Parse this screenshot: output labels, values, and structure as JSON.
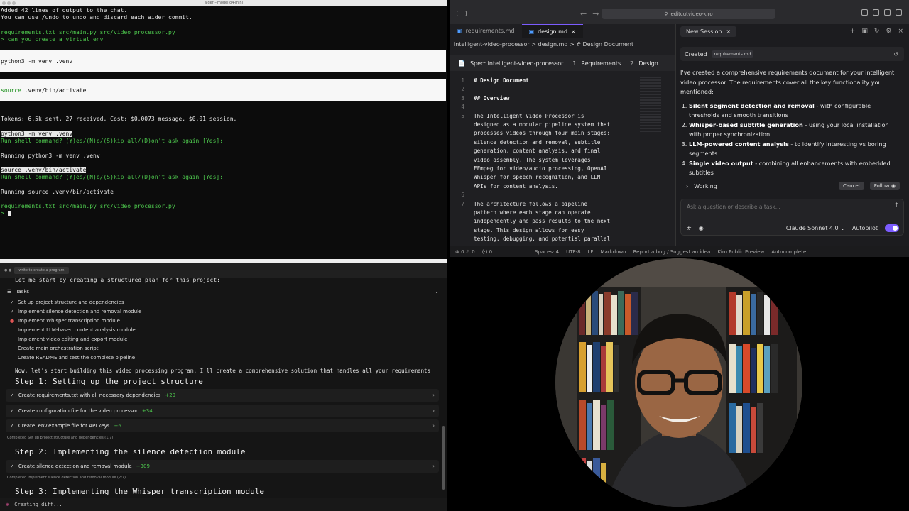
{
  "terminal": {
    "title": "aider --model o4-mini",
    "lines": [
      "Added 42 lines of output to the chat.",
      "You can use /undo to undo and discard each aider commit.",
      "requirements.txt src/main.py src/video_processor.py",
      "> can you create a virtual env",
      "python3 -m venv .venv",
      "source .venv/bin/activate",
      "Tokens: 6.5k sent, 27 received. Cost: $0.0073 message, $0.01 session.",
      "python3 -m venv .venv",
      "Run shell command? (Y)es/(N)o/(S)kip all/(D)on't ask again [Yes]:",
      "Running python3 -m venv .venv",
      "source .venv/bin/activate",
      "Run shell command? (Y)es/(N)o/(S)kip all/(D)on't ask again [Yes]:",
      "Running source .venv/bin/activate",
      "requirements.txt src/main.py src/video_processor.py",
      ">"
    ],
    "code_kw": "source"
  },
  "chat": {
    "tab_label": "write to create a program",
    "intro": "Let me start by creating a structured plan for this project:",
    "tasks_label": "Tasks",
    "tasks": [
      {
        "label": "Set up project structure and dependencies",
        "state": "done"
      },
      {
        "label": "Implement silence detection and removal module",
        "state": "done"
      },
      {
        "label": "Implement Whisper transcription module",
        "state": "active"
      },
      {
        "label": "Implement LLM-based content analysis module",
        "state": "todo"
      },
      {
        "label": "Implement video editing and export module",
        "state": "todo"
      },
      {
        "label": "Create main orchestration script",
        "state": "todo"
      },
      {
        "label": "Create README and test the complete pipeline",
        "state": "todo"
      }
    ],
    "now_text": "Now, let's start building this video processing program. I'll create a comprehensive solution that handles all your requirements.",
    "step1": "Step 1: Setting up the project structure",
    "rows1": [
      {
        "label": "Create requirements.txt with all necessary dependencies",
        "delta": "+29"
      },
      {
        "label": "Create configuration file for the video processor",
        "delta": "+34"
      },
      {
        "label": "Create .env.example file for API keys",
        "delta": "+6"
      }
    ],
    "completed1": "Completed Set up project structure and dependencies (1/7)",
    "step2": "Step 2: Implementing the silence detection module",
    "rows2": [
      {
        "label": "Create silence detection and removal module",
        "delta": "+309"
      }
    ],
    "completed2": "Completed Implement silence detection and removal module (2/7)",
    "step3": "Step 3: Implementing the Whisper transcription module",
    "status": "Creating diff..."
  },
  "ide": {
    "search": "editcutvideo-kiro",
    "tabs": [
      "requirements.md",
      "design.md"
    ],
    "breadcrumb": "intelligent-video-processor  >  design.md  >  # Design Document",
    "spec_label": "Spec: intelligent-video-processor",
    "spec_steps": [
      {
        "num": "1",
        "label": "Requirements"
      },
      {
        "num": "2",
        "label": "Design"
      }
    ],
    "code": [
      {
        "n": "1",
        "t": "# Design Document",
        "bold": true
      },
      {
        "n": "2",
        "t": ""
      },
      {
        "n": "3",
        "t": "## Overview",
        "bold": true
      },
      {
        "n": "4",
        "t": ""
      },
      {
        "n": "5",
        "t": "The Intelligent Video Processor is"
      },
      {
        "n": "",
        "t": "designed as a modular pipeline system that"
      },
      {
        "n": "",
        "t": "processes videos through four main stages:"
      },
      {
        "n": "",
        "t": "silence detection and removal, subtitle"
      },
      {
        "n": "",
        "t": "generation, content analysis, and final"
      },
      {
        "n": "",
        "t": "video assembly. The system leverages"
      },
      {
        "n": "",
        "t": "FFmpeg for video/audio processing, OpenAI"
      },
      {
        "n": "",
        "t": "Whisper for speech recognition, and LLM"
      },
      {
        "n": "",
        "t": "APIs for content analysis."
      },
      {
        "n": "6",
        "t": ""
      },
      {
        "n": "7",
        "t": "The architecture follows a pipeline"
      },
      {
        "n": "",
        "t": "pattern where each stage can operate"
      },
      {
        "n": "",
        "t": "independently and pass results to the next"
      },
      {
        "n": "",
        "t": "stage. This design allows for easy"
      },
      {
        "n": "",
        "t": "testing, debugging, and potential parallel"
      }
    ],
    "status": {
      "problems": "⊗ 0 ⚠ 0",
      "ports": "(·) 0",
      "spaces": "Spaces: 4",
      "encoding": "UTF-8",
      "eol": "LF",
      "lang": "Markdown",
      "bug": "Report a bug / Suggest an idea",
      "preview": "Kiro Public Preview",
      "autocomplete": "Autocomplete"
    },
    "agent": {
      "tab": "New Session",
      "created_label": "Created",
      "created_file": "requirements.md",
      "intro": "I've created a comprehensive requirements document for your intelligent video processor. The requirements cover all the key functionality you mentioned:",
      "items": [
        {
          "bold": "Silent segment detection and removal",
          "rest": " - with configurable thresholds and smooth transitions"
        },
        {
          "bold": "Whisper-based subtitle generation",
          "rest": " - using your local installation with proper synchronization"
        },
        {
          "bold": "LLM-powered content analysis",
          "rest": " - to identify interesting vs boring segments"
        },
        {
          "bold": "Single video output",
          "rest": " - combining all enhancements with embedded subtitles"
        }
      ],
      "working": "Working",
      "cancel": "Cancel",
      "follow": "Follow",
      "placeholder": "Ask a question or describe a task...",
      "model": "Claude Sonnet 4.0",
      "autopilot": "Autopilot"
    }
  }
}
